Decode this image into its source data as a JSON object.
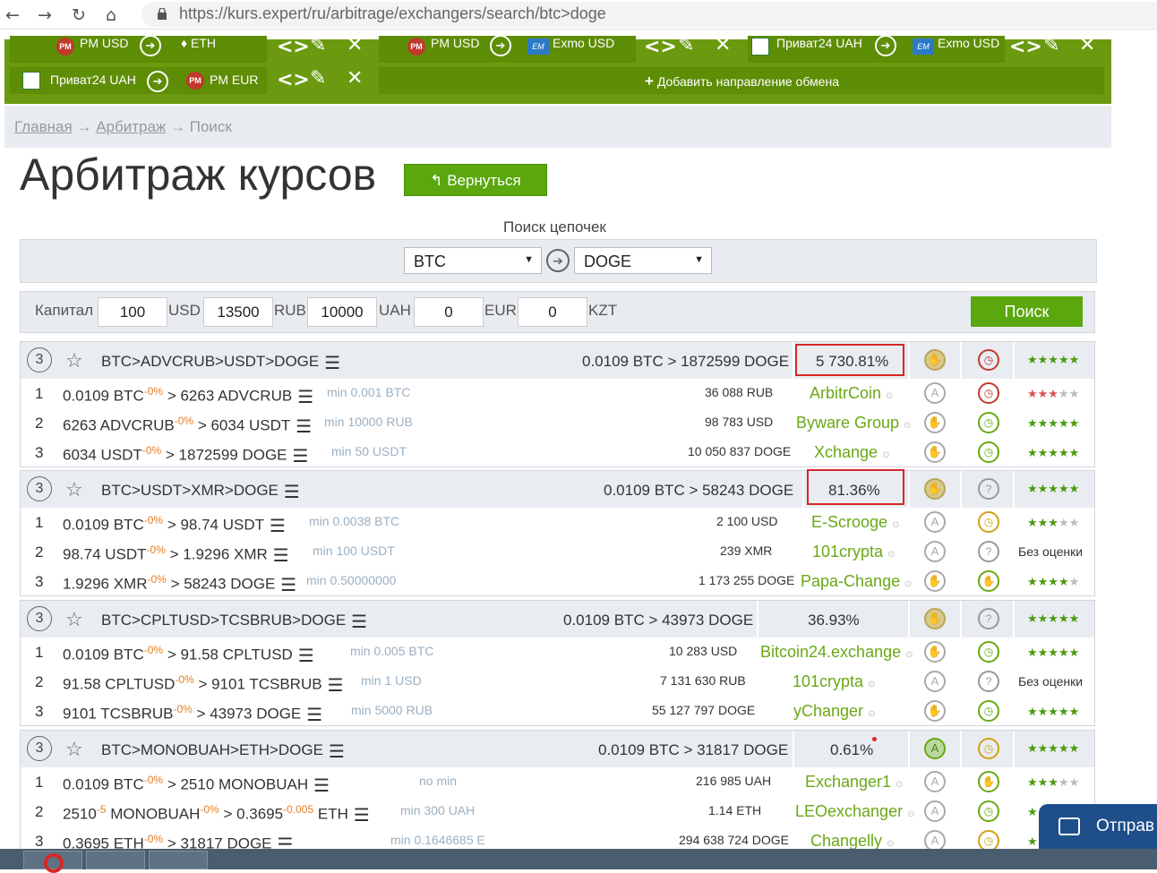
{
  "browser": {
    "url": "https://kurs.expert/ru/arbitrage/exchangers/search/btc>doge",
    "back": "←",
    "forward": "→",
    "reload": "↻",
    "home": "⌂"
  },
  "directions": {
    "row1": {
      "a_from": "PM USD",
      "a_to": "ETH",
      "b_from": "PM USD",
      "b_to": "Exmo USD",
      "c_from": "Приват24 UAH",
      "c_to": "Exmo USD"
    },
    "row2": {
      "from": "Приват24 UAH",
      "to": "PM EUR",
      "add_label": "Добавить направление обмена"
    }
  },
  "breadcrumb": {
    "home": "Главная",
    "sep": "→",
    "arbitrage": "Арбитраж",
    "current": "Поиск"
  },
  "page": {
    "title": "Арбитраж курсов",
    "back_button": "Вернуться"
  },
  "search": {
    "label": "Поиск цепочек",
    "from": "BTC",
    "to": "DOGE"
  },
  "capital": {
    "label": "Капитал",
    "values": [
      "100",
      "13500",
      "10000",
      "0",
      "0"
    ],
    "currencies": [
      "USD",
      "RUB",
      "UAH",
      "EUR",
      "KZT"
    ],
    "search_button": "Поиск"
  },
  "groups": [
    {
      "steps": "3",
      "chain": "BTC>ADVCRUB>USDT>DOGE",
      "summary": "0.0109 BTC > 1872599 DOGE",
      "profit": "5 730.81%",
      "rows": [
        {
          "n": "1",
          "from": "0.0109 BTC",
          "fee": "-0%",
          "to": "> 6263 ADVCRUB",
          "min": "min 0.001 BTC",
          "reserve": "36 088 RUB",
          "exchanger": "ArbitrCoin"
        },
        {
          "n": "2",
          "from": "6263 ADVCRUB",
          "fee": "-0%",
          "to": "> 6034 USDT",
          "min": "min 10000 RUB",
          "reserve": "98 783 USD",
          "exchanger": "Byware Group"
        },
        {
          "n": "3",
          "from": "6034 USDT",
          "fee": "-0%",
          "to": "> 1872599 DOGE",
          "min": "min 50 USDT",
          "reserve": "10 050 837 DOGE",
          "exchanger": "Xchange"
        }
      ]
    },
    {
      "steps": "3",
      "chain": "BTC>USDT>XMR>DOGE",
      "summary": "0.0109 BTC > 58243 DOGE",
      "profit": "81.36%",
      "rows": [
        {
          "n": "1",
          "from": "0.0109 BTC",
          "fee": "-0%",
          "to": "> 98.74 USDT",
          "min": "min 0.0038 BTC",
          "reserve": "2 100 USD",
          "exchanger": "E-Scrooge"
        },
        {
          "n": "2",
          "from": "98.74 USDT",
          "fee": "-0%",
          "to": "> 1.9296 XMR",
          "min": "min 100 USDT",
          "reserve": "239 XMR",
          "exchanger": "101crypta",
          "rating": "Без оценки"
        },
        {
          "n": "3",
          "from": "1.9296 XMR",
          "fee": "-0%",
          "to": "> 58243 DOGE",
          "min": "min 0.50000000",
          "reserve": "1 173 255 DOGE",
          "exchanger": "Papa-Change"
        }
      ]
    },
    {
      "steps": "3",
      "chain": "BTC>CPLTUSD>TCSBRUB>DOGE",
      "summary": "0.0109 BTC > 43973 DOGE",
      "profit": "36.93%",
      "rows": [
        {
          "n": "1",
          "from": "0.0109 BTC",
          "fee": "-0%",
          "to": "> 91.58 CPLTUSD",
          "min": "min 0.005 BTC",
          "reserve": "10 283 USD",
          "exchanger": "Bitcoin24.exchange"
        },
        {
          "n": "2",
          "from": "91.58 CPLTUSD",
          "fee": "-0%",
          "to": "> 9101 TCSBRUB",
          "min": "min 1 USD",
          "reserve": "7 131 630 RUB",
          "exchanger": "101crypta",
          "rating": "Без оценки"
        },
        {
          "n": "3",
          "from": "9101 TCSBRUB",
          "fee": "-0%",
          "to": "> 43973 DOGE",
          "min": "min 5000 RUB",
          "reserve": "55 127 797 DOGE",
          "exchanger": "yChanger"
        }
      ]
    },
    {
      "steps": "3",
      "chain": "BTC>MONOBUAH>ETH>DOGE",
      "summary": "0.0109 BTC > 31817 DOGE",
      "profit": "0.61%",
      "rows": [
        {
          "n": "1",
          "from": "0.0109 BTC",
          "fee": "-0%",
          "to": "> 2510 MONOBUAH",
          "min": "no min",
          "reserve": "216 985 UAH",
          "exchanger": "Exchanger1"
        },
        {
          "n": "2",
          "from": "2510",
          "fee2": "-5",
          "mid": "MONOBUAH",
          "fee": "-0%",
          "to": "> 0.3695",
          "fee3": "-0.005",
          "to2": "ETH",
          "min": "min 300 UAH",
          "reserve": "1.14 ETH",
          "exchanger": "LEOexchanger"
        },
        {
          "n": "3",
          "from": "0.3695 ETH",
          "fee": "-0%",
          "to": "> 31817 DOGE",
          "min": "min 0.1646685 E",
          "reserve": "294 638 724 DOGE",
          "exchanger": "Changelly"
        }
      ]
    }
  ],
  "send_button": "Отправ",
  "colors": {
    "green": "#6b9a10",
    "accent": "#5aa70e",
    "red": "#d62828"
  }
}
